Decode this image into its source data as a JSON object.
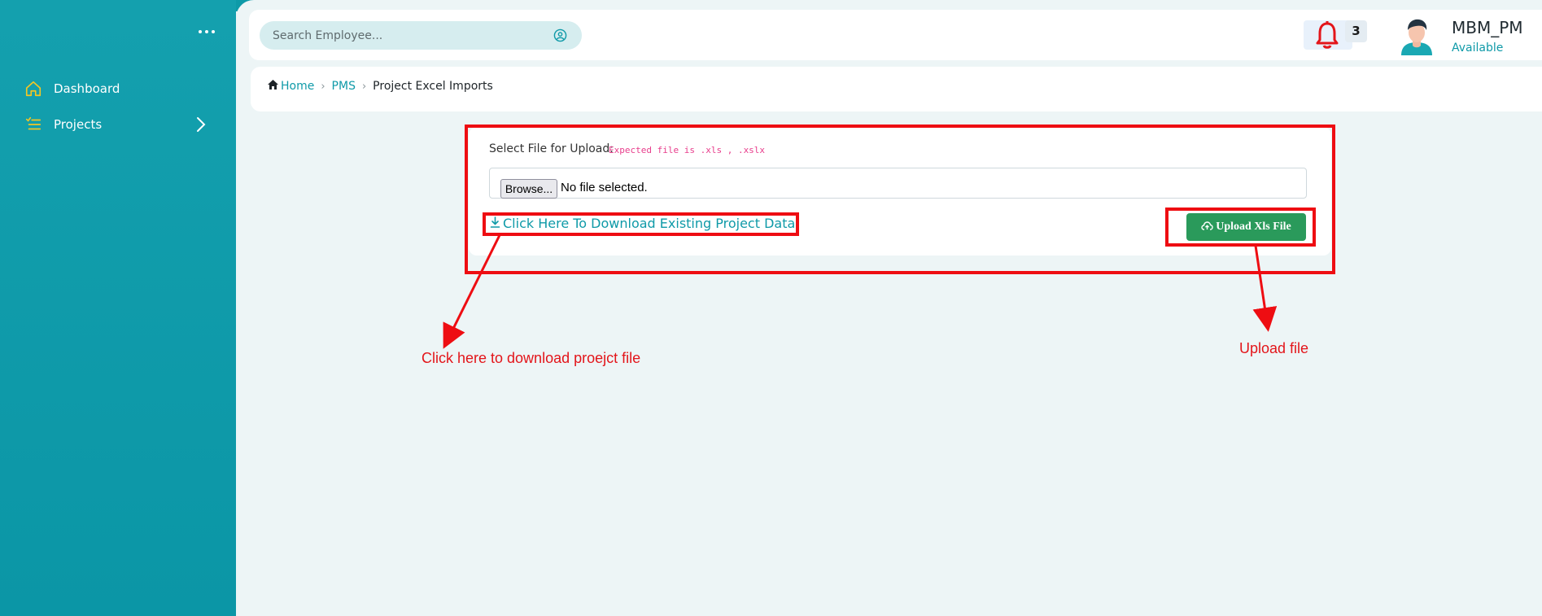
{
  "sidebar": {
    "menu_icon": "more-horizontal-icon",
    "items": [
      {
        "label": "Dashboard",
        "icon": "home-icon"
      },
      {
        "label": "Projects",
        "icon": "list-icon"
      }
    ]
  },
  "header": {
    "search_placeholder": "Search Employee...",
    "notification_count": "3",
    "user_name": "MBM_PM",
    "user_status": "Available"
  },
  "breadcrumb": {
    "home": "Home",
    "section": "PMS",
    "current": "Project Excel Imports"
  },
  "upload_form": {
    "label": "Select File for Upload:",
    "expected_hint": "Expected file is .xls , .xslx",
    "browse_label": "Browse...",
    "file_status": "No file selected.",
    "download_link": "Click Here To Download Existing Project Data",
    "upload_button": "Upload Xls File"
  },
  "annotations": {
    "download_note": "Click here to download proejct file",
    "upload_note": "Upload file",
    "color": "#e3151a"
  },
  "colors": {
    "sidebar": "#14a0ae",
    "accent": "#0f9aa8",
    "upload_button": "#2a9a5b",
    "bell": "#e3151a"
  }
}
